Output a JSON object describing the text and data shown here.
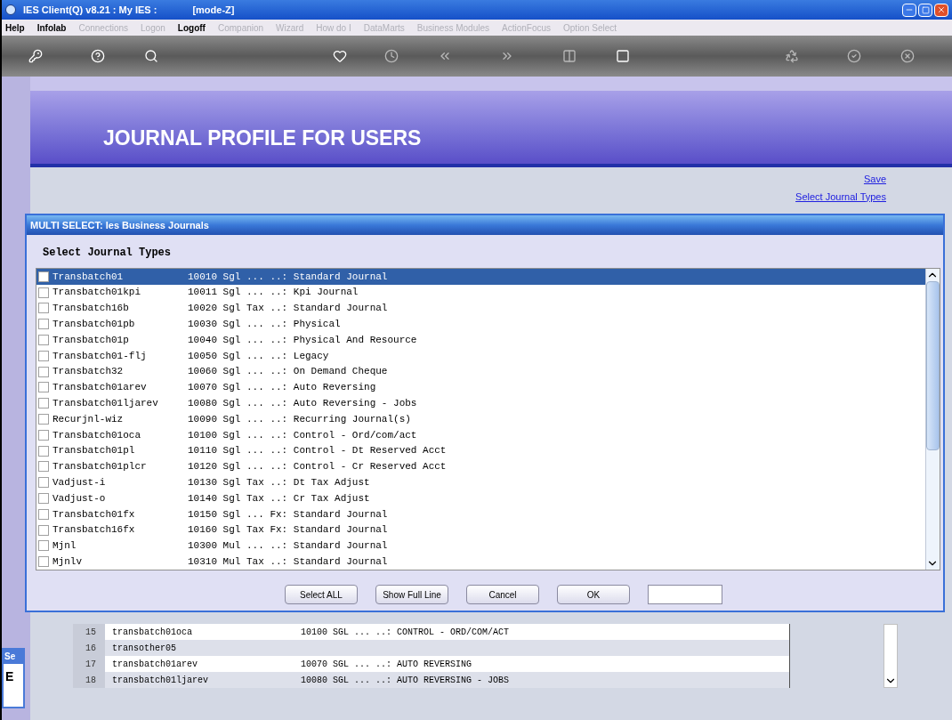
{
  "window": {
    "title": "IES Client(Q) v8.21 : My IES :",
    "mode": "[mode-Z]"
  },
  "menu": [
    {
      "label": "Help",
      "disabled": false
    },
    {
      "label": "Infolab",
      "disabled": false
    },
    {
      "label": "Connections",
      "disabled": true
    },
    {
      "label": "Logon",
      "disabled": true
    },
    {
      "label": "Logoff",
      "disabled": false
    },
    {
      "label": "Companion",
      "disabled": true
    },
    {
      "label": "Wizard",
      "disabled": true
    },
    {
      "label": "How do I",
      "disabled": true
    },
    {
      "label": "DataMarts",
      "disabled": true
    },
    {
      "label": "Business Modules",
      "disabled": true
    },
    {
      "label": "ActionFocus",
      "disabled": true
    },
    {
      "label": "Option Select",
      "disabled": true
    }
  ],
  "page": {
    "heading": "JOURNAL PROFILE FOR USERS",
    "links": [
      "Save",
      "Select Journal Types"
    ]
  },
  "background_table": {
    "rows": [
      {
        "number": "15",
        "name": "transbatch01oca",
        "detail": "10100 SGL ... ..: CONTROL - ORD/COM/ACT"
      },
      {
        "number": "16",
        "name": "transother05",
        "detail": ""
      },
      {
        "number": "17",
        "name": "transbatch01arev",
        "detail": "10070 SGL ... ..: AUTO REVERSING"
      },
      {
        "number": "18",
        "name": "transbatch01ljarev",
        "detail": "10080 SGL ... ..: AUTO REVERSING - JOBS"
      }
    ]
  },
  "side_window": {
    "title": "Se",
    "label": "E"
  },
  "dialog": {
    "title": "MULTI SELECT: Ies Business Journals",
    "heading": "Select Journal Types",
    "items": [
      {
        "name": "Transbatch01",
        "detail": "10010 Sgl ... ..: Standard Journal",
        "checked": false,
        "selected": true
      },
      {
        "name": "Transbatch01kpi",
        "detail": "10011 Sgl ... ..: Kpi Journal",
        "checked": false,
        "selected": false
      },
      {
        "name": "Transbatch16b",
        "detail": "10020 Sgl Tax ..: Standard Journal",
        "checked": false,
        "selected": false
      },
      {
        "name": "Transbatch01pb",
        "detail": "10030 Sgl ... ..: Physical",
        "checked": false,
        "selected": false
      },
      {
        "name": "Transbatch01p",
        "detail": "10040 Sgl ... ..: Physical And Resource",
        "checked": false,
        "selected": false
      },
      {
        "name": "Transbatch01-flj",
        "detail": "10050 Sgl ... ..: Legacy",
        "checked": false,
        "selected": false
      },
      {
        "name": "Transbatch32",
        "detail": "10060 Sgl ... ..: On Demand Cheque",
        "checked": false,
        "selected": false
      },
      {
        "name": "Transbatch01arev",
        "detail": "10070 Sgl ... ..: Auto Reversing",
        "checked": false,
        "selected": false
      },
      {
        "name": "Transbatch01ljarev",
        "detail": "10080 Sgl ... ..: Auto Reversing - Jobs",
        "checked": false,
        "selected": false
      },
      {
        "name": "Recurjnl-wiz",
        "detail": "10090 Sgl ... ..: Recurring Journal(s)",
        "checked": false,
        "selected": false
      },
      {
        "name": "Transbatch01oca",
        "detail": "10100 Sgl ... ..: Control - Ord/com/act",
        "checked": false,
        "selected": false
      },
      {
        "name": "Transbatch01pl",
        "detail": "10110 Sgl ... ..: Control - Dt Reserved Acct",
        "checked": false,
        "selected": false
      },
      {
        "name": "Transbatch01plcr",
        "detail": "10120 Sgl ... ..: Control - Cr Reserved Acct",
        "checked": false,
        "selected": false
      },
      {
        "name": "Vadjust-i",
        "detail": "10130 Sgl Tax ..: Dt Tax Adjust",
        "checked": false,
        "selected": false
      },
      {
        "name": "Vadjust-o",
        "detail": "10140 Sgl Tax ..: Cr Tax Adjust",
        "checked": false,
        "selected": false
      },
      {
        "name": "Transbatch01fx",
        "detail": "10150 Sgl ... Fx: Standard Journal",
        "checked": false,
        "selected": false
      },
      {
        "name": "Transbatch16fx",
        "detail": "10160 Sgl Tax Fx: Standard Journal",
        "checked": false,
        "selected": false
      },
      {
        "name": "Mjnl",
        "detail": "10300 Mul ... ..: Standard Journal",
        "checked": false,
        "selected": false
      },
      {
        "name": "Mjnlv",
        "detail": "10310 Mul Tax ..: Standard Journal",
        "checked": false,
        "selected": false
      }
    ],
    "buttons": [
      "Select ALL",
      "Show Full Line",
      "Cancel",
      "OK"
    ]
  }
}
